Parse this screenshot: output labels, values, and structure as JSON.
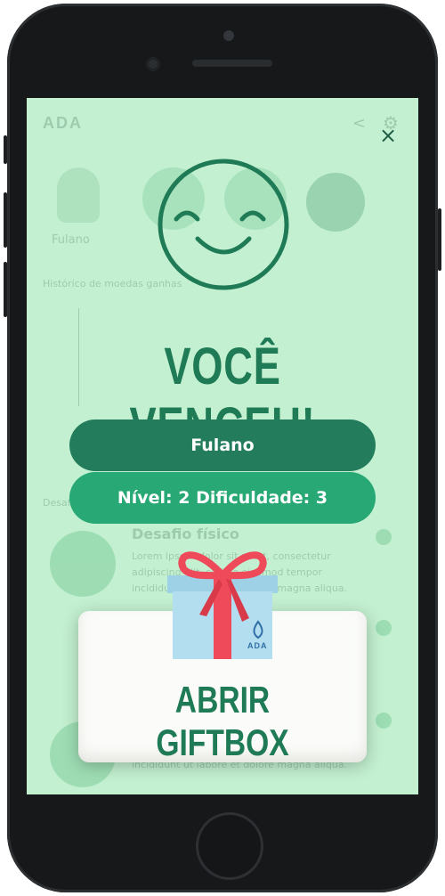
{
  "background_app": {
    "logo": "ADA",
    "user_name": "Fulano",
    "history_label": "Histórico de moedas ganhas",
    "section_label": "Desafios",
    "card_title": "Desafio físico",
    "card_text": "Lorem ipsum dolor sit amet, consectetur adipiscing elit, sed do eiusmod tempor incididunt ut labore et dolore magna aliqua.",
    "card_text_bottom": "incididunt ut labore et dolore magna aliqua."
  },
  "modal": {
    "title": "VOCÊ VENCEU!",
    "player_name": "Fulano",
    "level_info": "Nível: 2   Dificuldade: 3",
    "gift_button": "ABRIR GIFTBOX",
    "gift_brand": "ADA",
    "close_symbol": "×"
  },
  "colors": {
    "screen_bg": "#c3f0d0",
    "dark_green": "#237c5c",
    "mid_green": "#27a874",
    "title_green": "#1f7a56",
    "ribbon_red": "#ee4a5a",
    "box_blue": "#a9d8ec"
  },
  "icons": {
    "close": "close-icon",
    "smiley": "smiley-face-icon",
    "gift": "gift-box-icon",
    "share": "share-icon",
    "settings": "gear-icon"
  }
}
